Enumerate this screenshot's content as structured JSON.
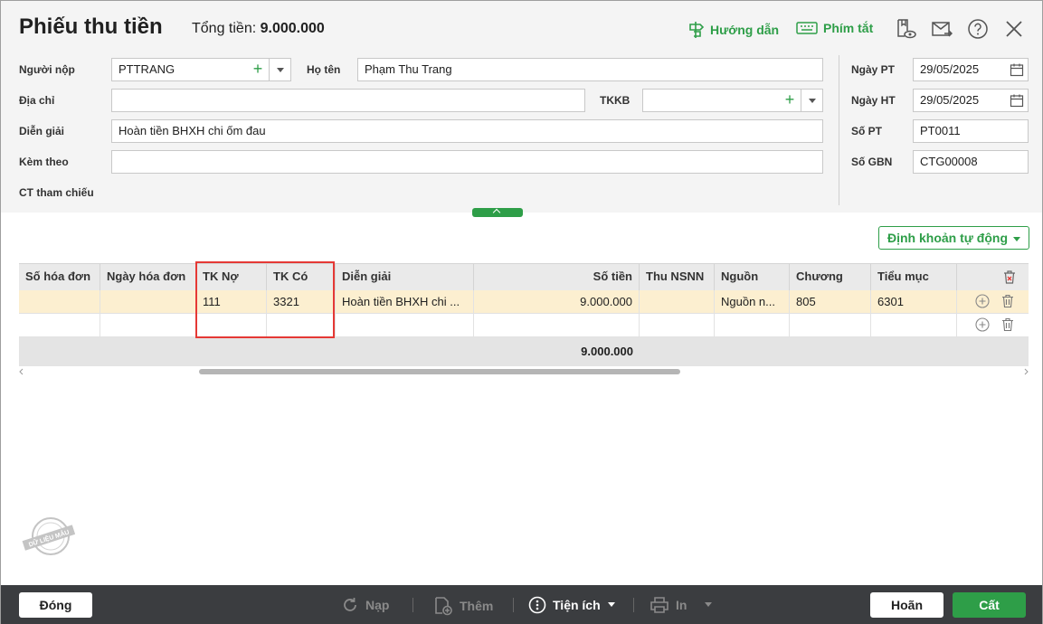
{
  "header": {
    "title": "Phiếu thu tiền",
    "total_label": "Tổng tiền:",
    "total_value": "9.000.000",
    "guide_label": "Hướng dẫn",
    "shortcut_label": "Phím tắt"
  },
  "form": {
    "payer_label": "Người nộp",
    "payer_value": "PTTRANG",
    "name_label": "Họ tên",
    "name_value": "Phạm Thu Trang",
    "address_label": "Địa chỉ",
    "address_value": "",
    "tkkb_label": "TKKB",
    "tkkb_value": "",
    "desc_label": "Diễn giải",
    "desc_value": "Hoàn tiền BHXH chi ốm đau",
    "attach_label": "Kèm theo",
    "attach_value": "",
    "ref_label": "CT tham chiếu",
    "date_pt_label": "Ngày PT",
    "date_pt_value": "29/05/2025",
    "date_ht_label": "Ngày HT",
    "date_ht_value": "29/05/2025",
    "no_pt_label": "Số PT",
    "no_pt_value": "PT0011",
    "no_gbn_label": "Số GBN",
    "no_gbn_value": "CTG00008"
  },
  "auto_entry_label": "Định khoản tự động",
  "grid": {
    "columns": [
      "Số hóa đơn",
      "Ngày hóa đơn",
      "TK Nợ",
      "TK Có",
      "Diễn giải",
      "Số tiền",
      "Thu NSNN",
      "Nguồn",
      "Chương",
      "Tiểu mục"
    ],
    "rows": [
      [
        "",
        "",
        "111",
        "3321",
        "Hoàn tiền BHXH chi ...",
        "9.000.000",
        "",
        "Nguồn n...",
        "805",
        "6301"
      ],
      [
        "",
        "",
        "",
        "",
        "",
        "",
        "",
        "",
        "",
        ""
      ]
    ],
    "total_amount": "9.000.000"
  },
  "watermark": "DỮ LIỆU MẪU",
  "footer": {
    "close_label": "Đóng",
    "reload_label": "Nạp",
    "add_label": "Thêm",
    "utility_label": "Tiện ích",
    "print_label": "In",
    "cancel_label": "Hoãn",
    "save_label": "Cất"
  },
  "colors": {
    "accent": "#2e9e48",
    "highlight_row": "#fcefd0",
    "annotation_box": "#e53935",
    "footer_bg": "#3b3d40"
  }
}
